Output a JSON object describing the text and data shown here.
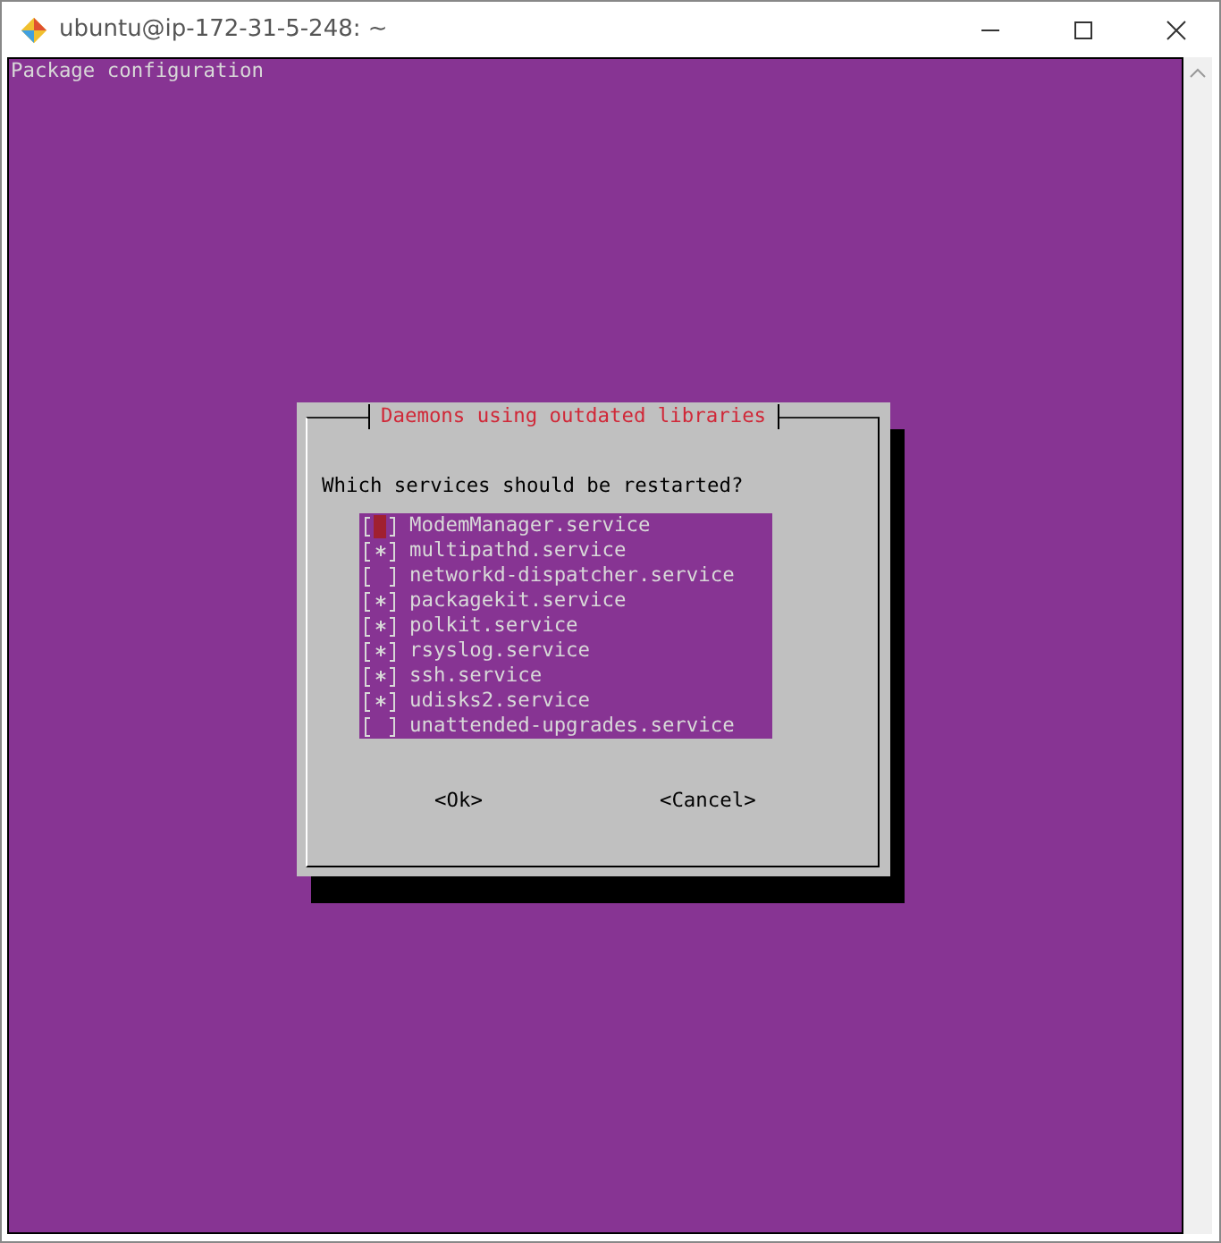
{
  "window": {
    "title": "ubuntu@ip-172-31-5-248: ~"
  },
  "terminal": {
    "header": "Package configuration"
  },
  "dialog": {
    "title": "Daemons using outdated libraries",
    "question": "Which services should be restarted?",
    "services": [
      {
        "name": "ModemManager.service",
        "checked": false,
        "selected": true
      },
      {
        "name": "multipathd.service",
        "checked": true,
        "selected": false
      },
      {
        "name": "networkd-dispatcher.service",
        "checked": false,
        "selected": false
      },
      {
        "name": "packagekit.service",
        "checked": true,
        "selected": false
      },
      {
        "name": "polkit.service",
        "checked": true,
        "selected": false
      },
      {
        "name": "rsyslog.service",
        "checked": true,
        "selected": false
      },
      {
        "name": "ssh.service",
        "checked": true,
        "selected": false
      },
      {
        "name": "udisks2.service",
        "checked": true,
        "selected": false
      },
      {
        "name": "unattended-upgrades.service",
        "checked": false,
        "selected": false
      }
    ],
    "buttons": [
      "<Ok>",
      "<Cancel>"
    ]
  }
}
